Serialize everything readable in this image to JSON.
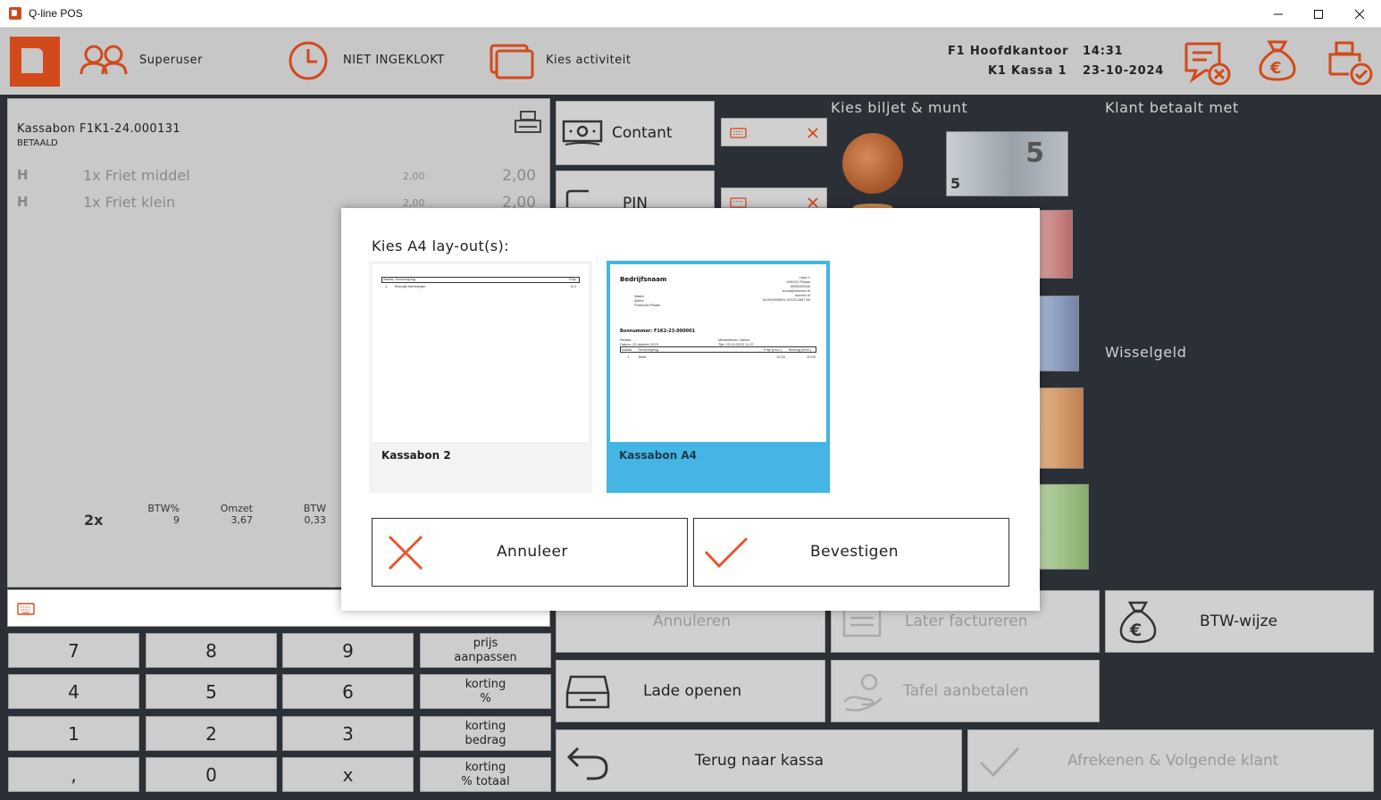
{
  "window": {
    "title": "Q-line POS"
  },
  "header": {
    "user": "Superuser",
    "clock_status": "NIET INGEKLOKT",
    "activity": "Kies activiteit",
    "location": "F1 Hoofdkantoor",
    "register": "K1 Kassa 1",
    "time": "14:31",
    "date": "23-10-2024"
  },
  "receipt": {
    "title": "Kassabon F1K1-24.000131",
    "status": "BETAALD",
    "lines": [
      {
        "code": "H",
        "desc": "1x Friet middel",
        "unit": "2,00",
        "total": "2,00"
      },
      {
        "code": "H",
        "desc": "1x Friet klein",
        "unit": "2,00",
        "total": "2,00"
      }
    ],
    "qty": "2x",
    "summary": {
      "btw_pct_label": "BTW%",
      "btw_pct": "9",
      "omzet_label": "Omzet",
      "omzet": "3,67",
      "btw_label": "BTW",
      "btw": "0,33"
    }
  },
  "numpad": {
    "keys": [
      "7",
      "8",
      "9",
      "4",
      "5",
      "6",
      "1",
      "2",
      "3",
      ",",
      "0",
      "x"
    ],
    "prijs_aanpassen_1": "prijs",
    "prijs_aanpassen_2": "aanpassen",
    "korting_pct_1": "korting",
    "korting_pct_2": "%",
    "korting_bedrag_1": "korting",
    "korting_bedrag_2": "bedrag",
    "korting_totaal_1": "korting",
    "korting_totaal_2": "% totaal"
  },
  "payment": {
    "contant": "Contant",
    "pin": "PIN"
  },
  "sections": {
    "kies_biljet": "Kies biljet & munt",
    "klant_betaalt": "Klant betaalt met",
    "wisselgeld": "Wisselgeld"
  },
  "actions": {
    "annuleren": "Annuleren",
    "later_factureren": "Later factureren",
    "btw_wijze": "BTW-wijze",
    "lade_openen": "Lade openen",
    "tafel_aanbetalen": "Tafel aanbetalen",
    "terug_naar_kassa": "Terug naar kassa",
    "afrekenen": "Afrekenen & Volgende klant"
  },
  "modal": {
    "title": "Kies A4 lay-out(s):",
    "layouts": [
      {
        "name": "Kassabon 2",
        "selected": false
      },
      {
        "name": "Kassabon A4",
        "selected": true
      }
    ],
    "cancel": "Annuleer",
    "confirm": "Bevestigen",
    "preview1": {
      "col_aantal": "Aantal",
      "col_omschr": "Omschrijving",
      "col_prijs": "Prijs",
      "row_qty": "1",
      "row_desc": "Broodje hamburger",
      "row_price": "9,0"
    },
    "preview2": {
      "company": "Bedrijfsnaam",
      "company_lines": [
        "Laan 1",
        "0000XX Plaats",
        "0000000000",
        "email@domein.nl",
        "domein.nl",
        "NL000000B01 IO123.4567.89"
      ],
      "cust_lines": [
        "Naam",
        "Adres",
        "Postcode Plaats"
      ],
      "bon": "Bonnummer: F1K2-23.000001",
      "meta_left": [
        "Relatie:",
        "Datum: 23 oktober 2023"
      ],
      "meta_right": [
        "Medewerker: Naam",
        "Tijd: 23-10-2023 11:37"
      ],
      "th_aantal": "Aantal",
      "th_omschr": "Omschrijving",
      "th_prijs": "Prijs (excl.)",
      "th_bedrag": "Bedrag (excl.)",
      "row_qty": "1",
      "row_desc": "Tekst",
      "row_prijs": "10,00",
      "row_bedrag": "10,00"
    }
  },
  "colors": {
    "accent": "#d24a1c",
    "selected": "#45b5e3",
    "background": "#2b2f36",
    "panel": "#c9c9c9"
  }
}
